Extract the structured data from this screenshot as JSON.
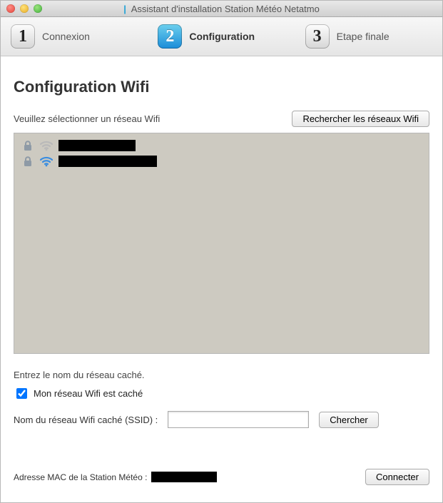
{
  "window": {
    "title": "Assistant d'installation Station Météo Netatmo"
  },
  "steps": {
    "s1": {
      "num": "1",
      "label": "Connexion"
    },
    "s2": {
      "num": "2",
      "label": "Configuration"
    },
    "s3": {
      "num": "3",
      "label": "Etape finale"
    }
  },
  "page": {
    "heading": "Configuration Wifi",
    "select_hint": "Veuillez sélectionner un réseau Wifi",
    "rescan_btn": "Rechercher les réseaux Wifi",
    "hidden_hint": "Entrez le nom du réseau caché.",
    "hidden_checkbox_label": "Mon réseau Wifi est caché",
    "hidden_checked": true,
    "ssid_label": "Nom du réseau Wifi caché (SSID) :",
    "ssid_value": "",
    "search_btn": "Chercher",
    "mac_label": "Adresse MAC de la Station Météo :",
    "connect_btn": "Connecter"
  }
}
